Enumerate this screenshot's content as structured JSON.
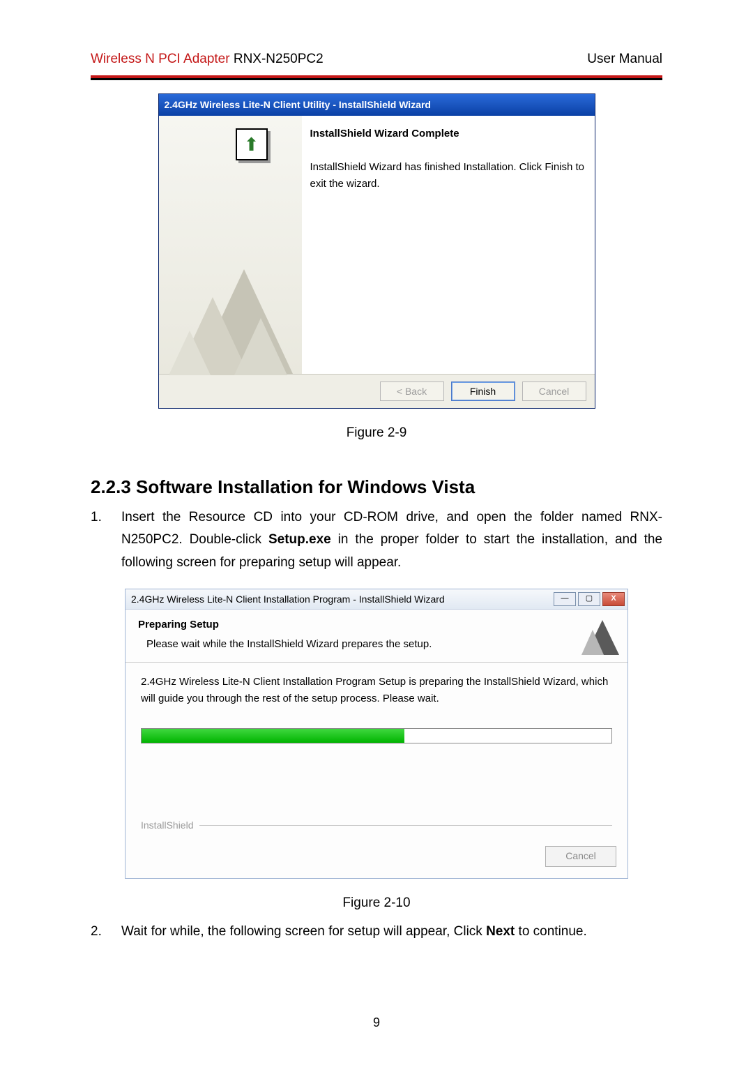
{
  "header": {
    "left_red": "Wireless N PCI Adapter",
    "left_black": " RNX-N250PC2",
    "right": "User Manual"
  },
  "fig29": {
    "title": "2.4GHz Wireless Lite-N Client Utility - InstallShield Wizard",
    "heading": "InstallShield Wizard Complete",
    "text": "InstallShield Wizard has finished Installation. Click Finish to exit the wizard.",
    "btn_back": "< Back",
    "btn_finish": "Finish",
    "btn_cancel": "Cancel",
    "caption": "Figure 2-9"
  },
  "section": {
    "heading": "2.2.3 Software Installation for Windows Vista",
    "step1_num": "1.",
    "step1_a": "Insert the Resource CD into your CD-ROM drive, and open the folder named RNX-N250PC2. Double-click ",
    "step1_b": "Setup.exe",
    "step1_c": " in the proper folder to start the installation, and the following screen for preparing setup will appear.",
    "step2_num": "2.",
    "step2_a": "Wait for while, the following screen for setup will appear, Click ",
    "step2_b": "Next",
    "step2_c": " to continue."
  },
  "fig210": {
    "title": "2.4GHz Wireless Lite-N Client Installation Program - InstallShield Wizard",
    "hdr_bold": "Preparing Setup",
    "hdr_sub": "Please wait while the InstallShield Wizard prepares the setup.",
    "body": "2.4GHz Wireless Lite-N Client Installation Program Setup is preparing the InstallShield Wizard, which will guide you through the rest of the setup process. Please wait.",
    "brand": "InstallShield",
    "btn_cancel": "Cancel",
    "caption": "Figure 2-10"
  },
  "page_number": "9"
}
